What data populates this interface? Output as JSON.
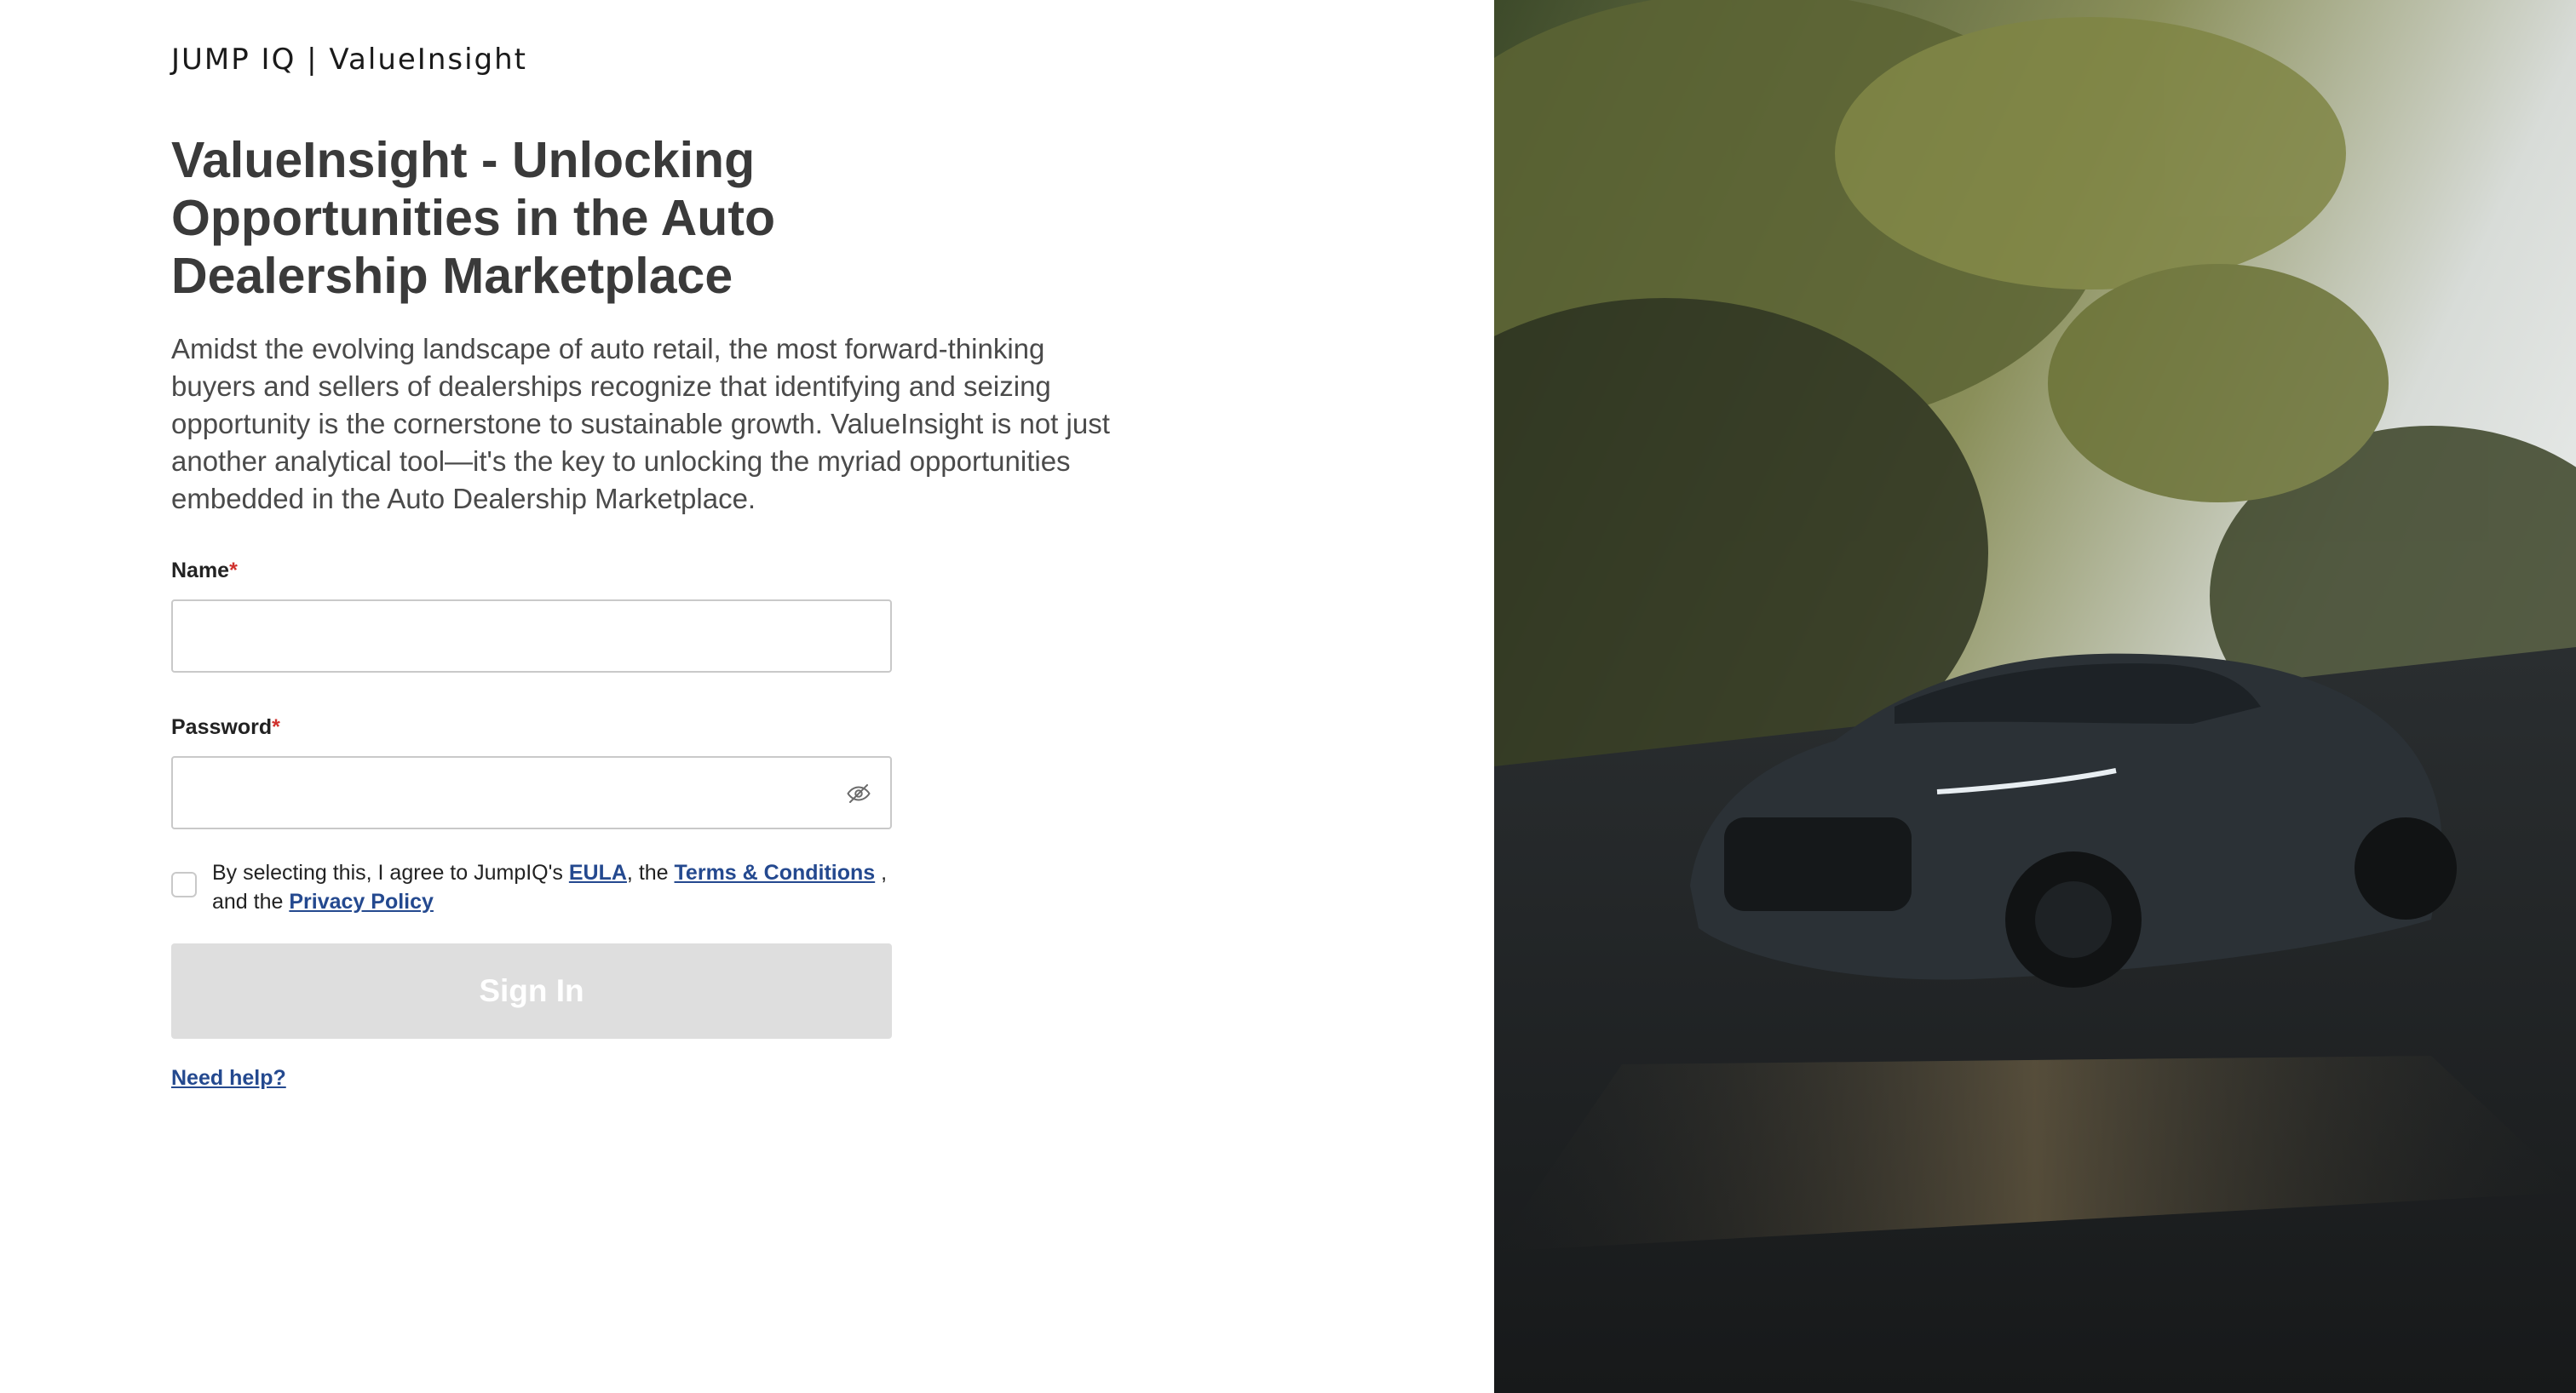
{
  "brand": "JUMP IQ | ValueInsight",
  "title": "ValueInsight - Unlocking Opportunities in the Auto Dealership Marketplace",
  "description": "Amidst the evolving landscape of auto retail, the most forward-thinking buyers and sellers of dealerships recognize that identifying and seizing opportunity is the cornerstone to sustainable growth. ValueInsight is not just another analytical tool—it's the key to unlocking the myriad opportunities embedded in the Auto Dealership Marketplace.",
  "form": {
    "name_label": "Name",
    "name_value": "",
    "password_label": "Password",
    "password_value": "",
    "required_mark": "*",
    "agree_prefix": "By selecting this, I agree to JumpIQ's ",
    "eula_link": "EULA",
    "agree_mid": ", the ",
    "terms_link": "Terms & Conditions",
    "agree_mid2": " , and the ",
    "privacy_link": "Privacy Policy",
    "agree_checked": false,
    "signin_label": "Sign In",
    "help_link": "Need help?"
  },
  "icons": {
    "password_toggle": "eye-slash-icon"
  },
  "colors": {
    "link": "#24498f",
    "required": "#d0312d",
    "button_disabled": "#dedede"
  }
}
